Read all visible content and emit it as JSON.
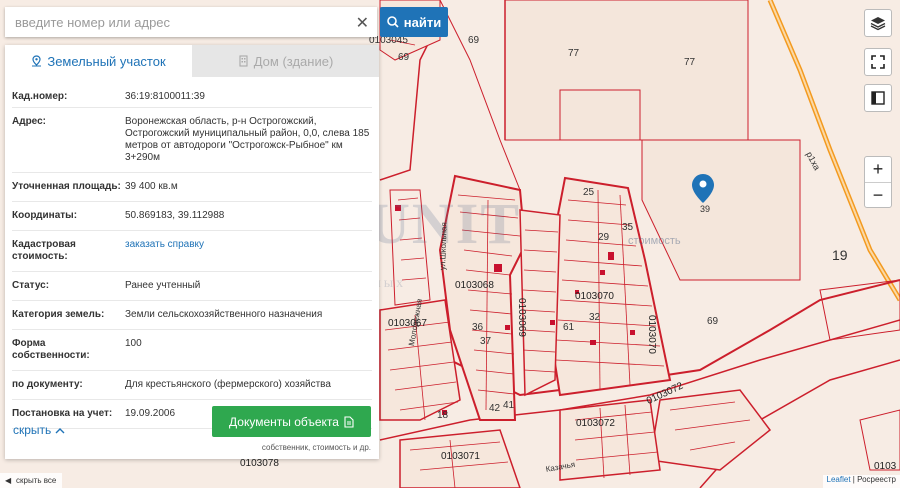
{
  "search": {
    "placeholder": "введите номер или адрес",
    "find_label": "найти"
  },
  "tabs": [
    {
      "label": "Земельный участок",
      "active": true
    },
    {
      "label": "Дом (здание)",
      "active": false
    }
  ],
  "info_rows": [
    {
      "label": "Кад.номер:",
      "value": "36:19:8100011:39"
    },
    {
      "label": "Адрес:",
      "value": "Воронежская область, р-н Острогожский, Острогожский муниципальный район, 0,0, слева 185 метров от автодороги \"Острогожск-Рыбное\" км 3+290м"
    },
    {
      "label": "Уточненная площадь:",
      "value": "39 400 кв.м"
    },
    {
      "label": "Координаты:",
      "value": "50.869183, 39.112988"
    },
    {
      "label": "Кадастровая стоимость:",
      "value": "заказать справку",
      "link": true
    },
    {
      "label": "Статус:",
      "value": "Ранее учтенный"
    },
    {
      "label": "Категория земель:",
      "value": "Земли сельскохозяйственного назначения"
    },
    {
      "label": "Форма собственности:",
      "value": "100"
    },
    {
      "label": "по документу:",
      "value": "Для крестьянского (фермерского) хозяйства"
    },
    {
      "label": "Постановка на учет:",
      "value": "19.09.2006"
    }
  ],
  "panel": {
    "hide_label": "скрыть",
    "docs_button": "Документы объекта",
    "docs_sub": "собственник, стоимость и др."
  },
  "map": {
    "watermark": "INFOUNIT",
    "watermark_sub": "Единая база данных",
    "overlay_text": "стоимость",
    "region_number": "19",
    "pin_label": "39",
    "street_1": "Молодежная",
    "street_2": "Казачья",
    "street_3": "ул.Школьная",
    "road": "р1ха",
    "labels": [
      "0103045",
      "77",
      "77",
      "69",
      "69",
      "0103068",
      "0103070",
      "0103067",
      "0103069",
      "0103070",
      "0103072",
      "0103072",
      "0103071",
      "0103078",
      "0103",
      "69",
      "25",
      "35",
      "29",
      "36",
      "37",
      "42",
      "41",
      "61",
      "32",
      "18"
    ]
  },
  "controls": {
    "zoom_in": "+",
    "zoom_out": "−",
    "collapse_all": "скрыть все"
  },
  "attribution": {
    "leaflet": "Leaflet",
    "rosreestr": "Росреестр"
  },
  "colors": {
    "accent": "#1f73b7",
    "doc_button": "#2fa84f",
    "boundary": "#c8102e",
    "road": "#f39a1f"
  }
}
